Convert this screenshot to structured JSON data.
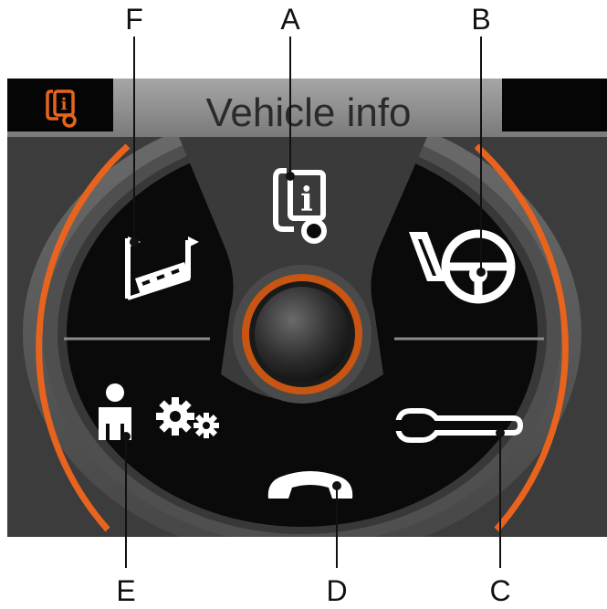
{
  "header": {
    "title": "Vehicle info"
  },
  "callouts": {
    "A": "A",
    "B": "B",
    "C": "C",
    "D": "D",
    "E": "E",
    "F": "F"
  },
  "icons": {
    "header_icon": "vehicle-info-icon",
    "top": "vehicle-info-icon",
    "upper_right": "driver-assist-steering-wheel-icon",
    "lower_right": "service-wrench-icon",
    "bottom": "phone-handset-icon",
    "lower_left": "personal-settings-gears-icon",
    "upper_left": "trip-route-flags-icon"
  },
  "colors": {
    "accent": "#e8641e",
    "panel": "#0a0a0a",
    "bezel": "#5a5a5a",
    "header_bar": "#8f8f8f"
  }
}
